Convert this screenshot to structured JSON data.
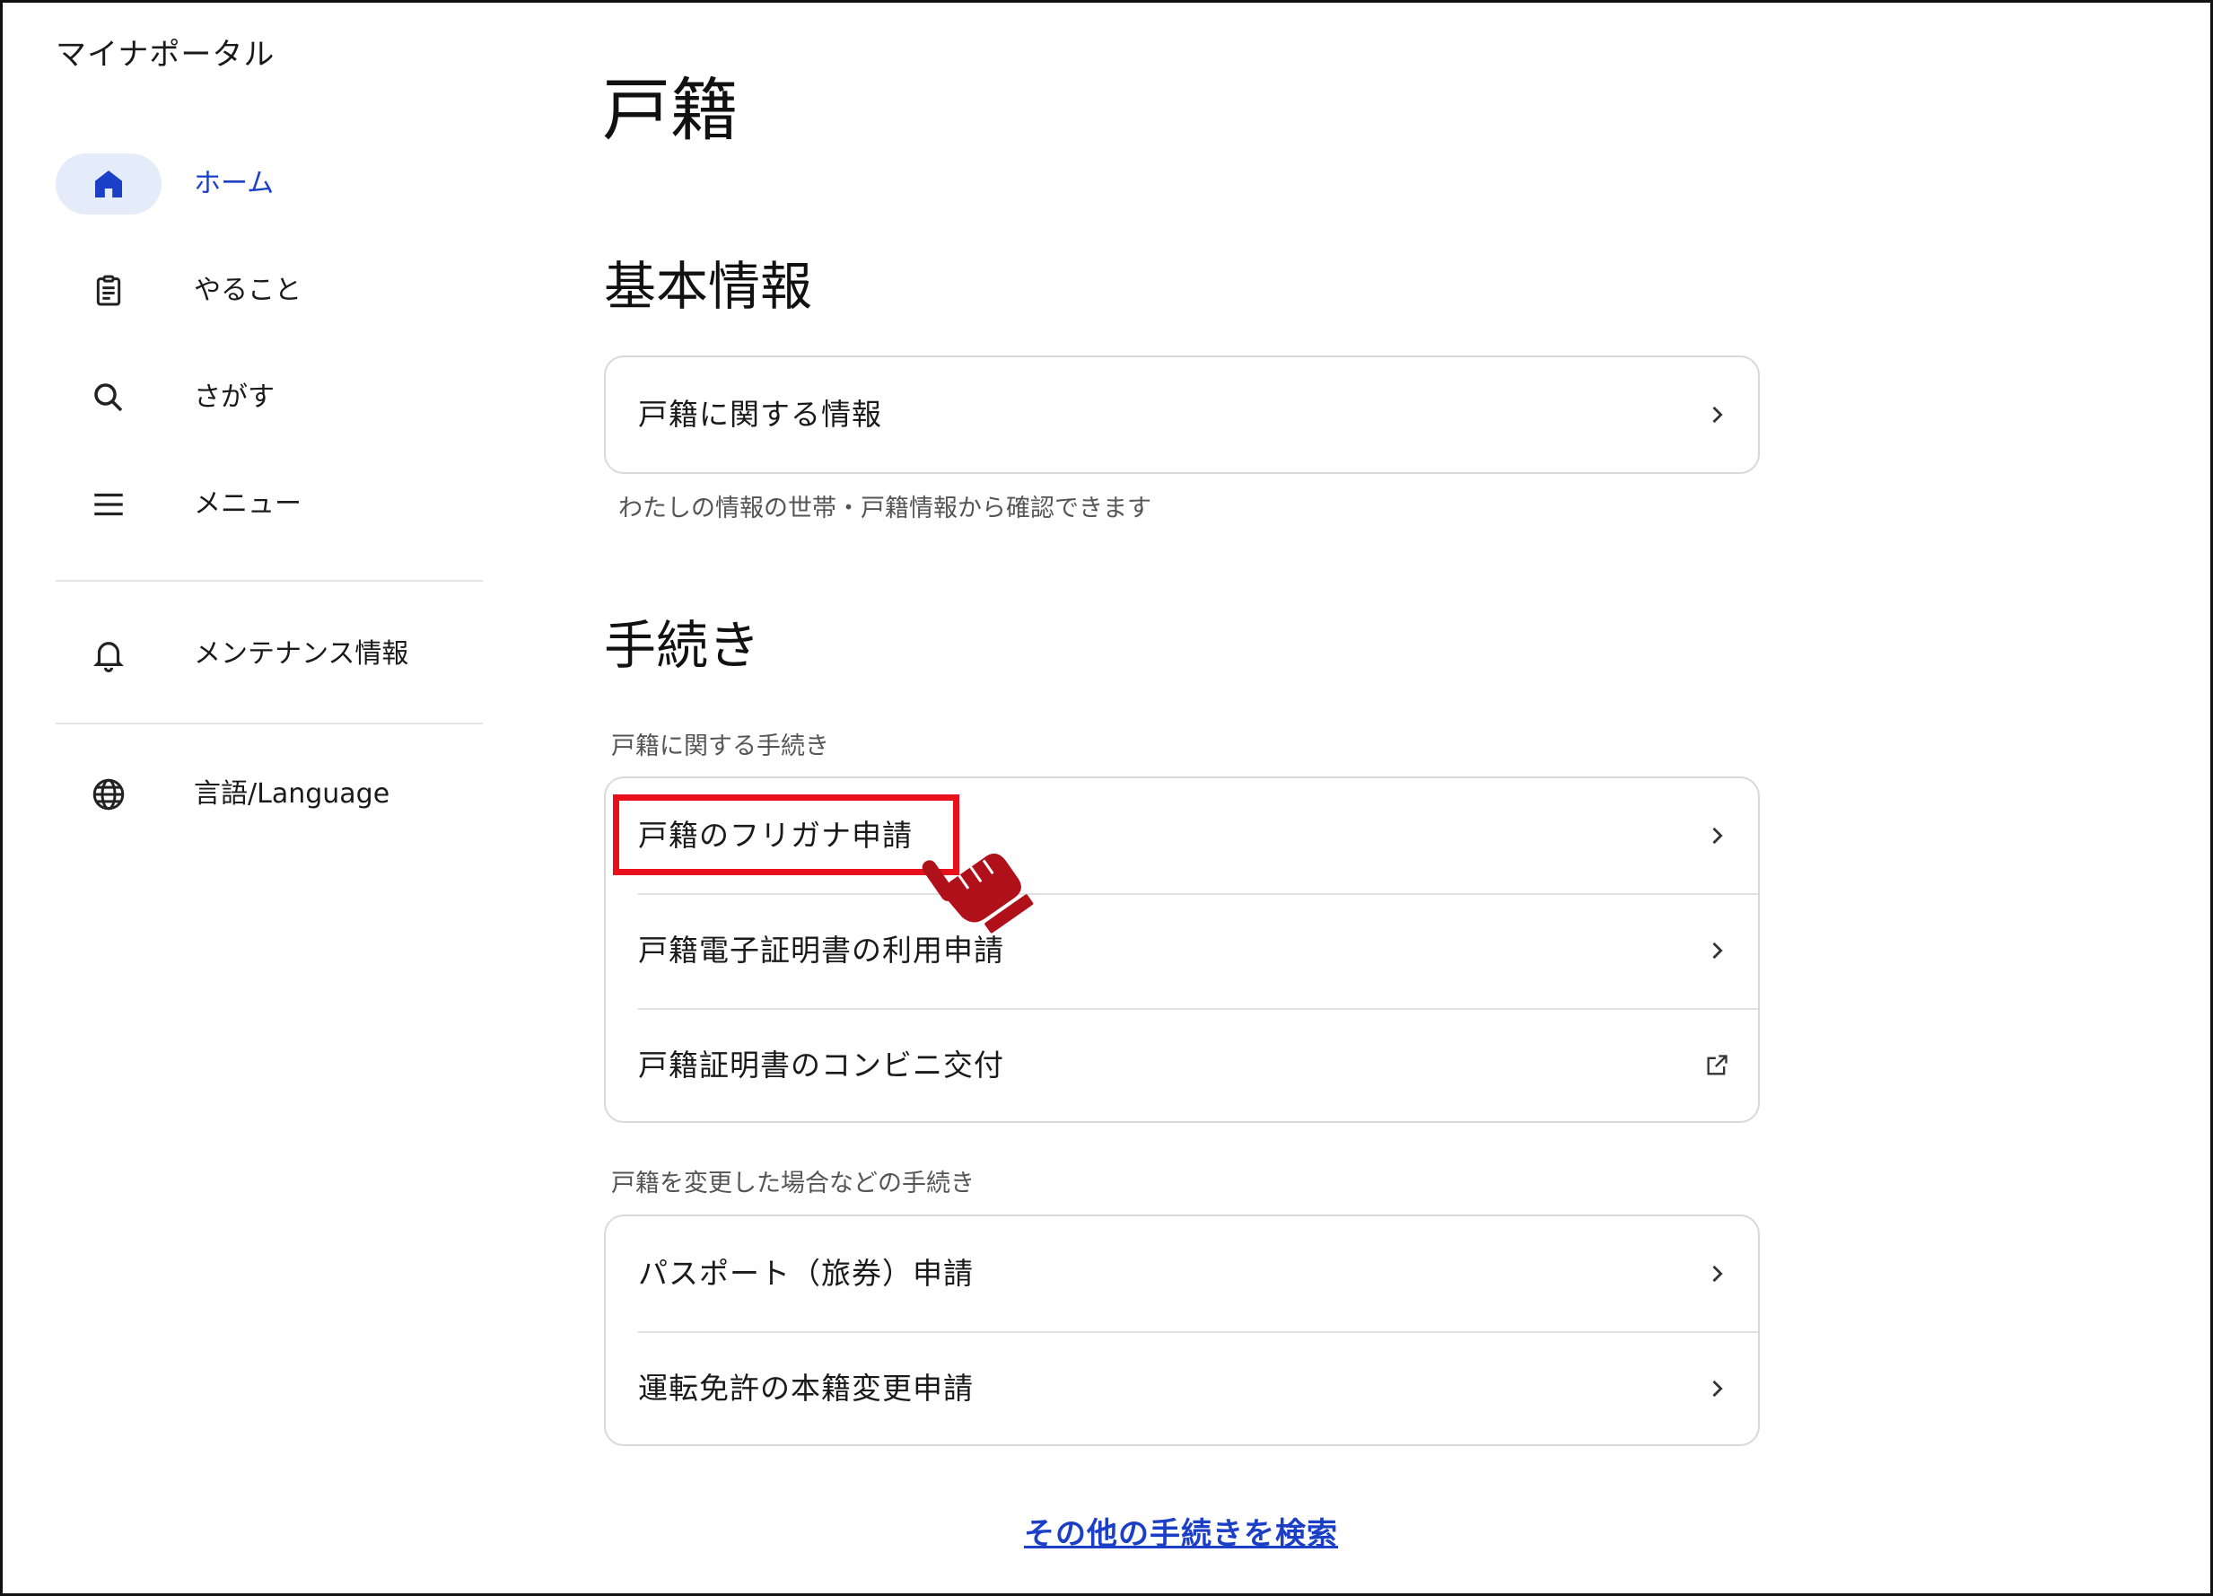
{
  "app": {
    "title": "マイナポータル"
  },
  "sidebar": {
    "items": [
      {
        "label": "ホーム",
        "icon": "home-icon",
        "active": true
      },
      {
        "label": "やること",
        "icon": "clipboard-icon"
      },
      {
        "label": "さがす",
        "icon": "search-icon"
      },
      {
        "label": "メニュー",
        "icon": "menu-icon"
      },
      {
        "label": "メンテナンス情報",
        "icon": "bell-icon"
      },
      {
        "label": "言語/Language",
        "icon": "globe-icon"
      }
    ]
  },
  "main": {
    "page_title": "戸籍",
    "basic": {
      "title": "基本情報",
      "card_item": "戸籍に関する情報",
      "note": "わたしの情報の世帯・戸籍情報から確認できます"
    },
    "procedures": {
      "title": "手続き",
      "group1": {
        "label": "戸籍に関する手続き",
        "items": [
          "戸籍のフリガナ申請",
          "戸籍電子証明書の利用申請",
          "戸籍証明書のコンビニ交付"
        ]
      },
      "group2": {
        "label": "戸籍を変更した場合などの手続き",
        "items": [
          "パスポート（旅券）申請",
          "運転免許の本籍変更申請"
        ]
      }
    },
    "search_link": "その他の手続きを検索"
  },
  "colors": {
    "accent": "#1b3fc7",
    "active_bg": "#e4ecfa",
    "highlight": "#e8101a",
    "pointer": "#b0101a"
  }
}
